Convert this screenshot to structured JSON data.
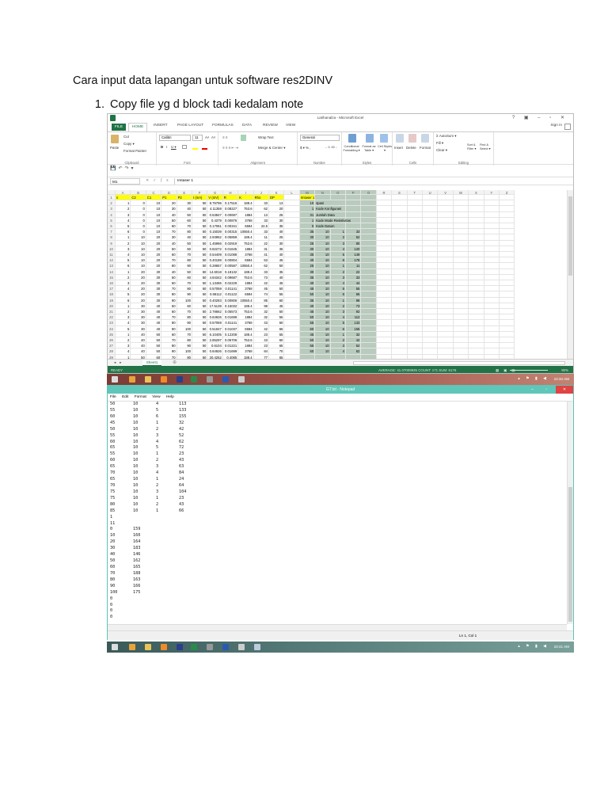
{
  "doc": {
    "title": "Cara input data lapangan untuk software res2DINV",
    "step_number": "1.",
    "step_text": "Copy file yg d block tadi kedalam note"
  },
  "excel": {
    "title": "Latihanalza - Microsoft Excel",
    "window_buttons": "? ▣ – ▫ ✕",
    "sign_in": "Sign in",
    "tabs": [
      "FILE",
      "HOME",
      "INSERT",
      "PAGE LAYOUT",
      "FORMULAS",
      "DATA",
      "REVIEW",
      "VIEW"
    ],
    "ribbon": {
      "clipboard": {
        "label": "Clipboard",
        "paste": "Paste",
        "cut": "Cut",
        "copy": "Copy ▾",
        "format_painter": "Format Painter"
      },
      "font": {
        "label": "Font",
        "name": "Calibri",
        "size": "11",
        "grow": "A˄",
        "shrink": "A˅",
        "bold": "B",
        "italic": "I",
        "underline": "U ▾"
      },
      "alignment": {
        "label": "Alignment",
        "wrap": "Wrap Text",
        "merge": "Merge & Center ▾"
      },
      "number": {
        "label": "Number",
        "format": "General",
        "currency": "$ ▾ % ,",
        "decimals": "←.0 .00→"
      },
      "styles": {
        "label": "Styles",
        "conditional": "Conditional Formatting ▾",
        "format_table": "Format as Table ▾",
        "cell_styles": "Cell Styles ▾"
      },
      "cells": {
        "label": "Cells",
        "insert": "Insert",
        "delete": "Delete",
        "format": "Format"
      },
      "editing": {
        "label": "Editing",
        "autosum": "Σ AutoSum ▾",
        "fill": "Fill ▾",
        "clear": "Clear ▾",
        "sort": "Sort & Filter ▾",
        "find": "Find & Select ▾"
      }
    },
    "name_box": "M1",
    "formula": "Imtaser 1",
    "columns": [
      "A",
      "B",
      "C",
      "D",
      "E",
      "F",
      "G",
      "H",
      "I",
      "J",
      "K",
      "L",
      "M",
      "N",
      "O",
      "P",
      "Q",
      "R",
      "S",
      "T",
      "U",
      "V",
      "W",
      "X",
      "Y",
      "Z"
    ],
    "header_row": [
      "n",
      "C2",
      "C1",
      "P1",
      "P2",
      "I (mA)",
      "V (mV)",
      "R",
      "K",
      "Rho",
      "DP"
    ],
    "rows": [
      [
        "1",
        "0",
        "10",
        "20",
        "30",
        "50",
        "8.75796",
        "0.17516",
        "188.4",
        "33",
        "13"
      ],
      [
        "2",
        "0",
        "10",
        "30",
        "40",
        "50",
        "4.11359",
        "0.08227",
        "753.6",
        "62",
        "20"
      ],
      [
        "3",
        "0",
        "10",
        "40",
        "50",
        "50",
        "0.53847",
        "0.00697",
        "1884",
        "13",
        "25"
      ],
      [
        "4",
        "0",
        "10",
        "50",
        "60",
        "50",
        "0.4379",
        "0.00876",
        "3768",
        "33",
        "30"
      ],
      [
        "5",
        "0",
        "10",
        "60",
        "70",
        "50",
        "0.17061",
        "0.00341",
        "6594",
        "22.5",
        "35"
      ],
      [
        "6",
        "0",
        "10",
        "70",
        "80",
        "50",
        "0.15039",
        "0.00315",
        "10550.4",
        "33",
        "40"
      ],
      [
        "1",
        "10",
        "20",
        "30",
        "40",
        "50",
        "2.93952",
        "0.05859",
        "188.4",
        "11",
        "25"
      ],
      [
        "2",
        "10",
        "20",
        "40",
        "50",
        "50",
        "1.45966",
        "0.02919",
        "753.6",
        "22",
        "30"
      ],
      [
        "3",
        "10",
        "20",
        "50",
        "60",
        "50",
        "0.82272",
        "0.01645",
        "1884",
        "31",
        "35"
      ],
      [
        "4",
        "10",
        "20",
        "60",
        "70",
        "50",
        "0.54409",
        "0.01088",
        "3768",
        "41",
        "40"
      ],
      [
        "5",
        "10",
        "20",
        "70",
        "80",
        "50",
        "0.40188",
        "0.00804",
        "6594",
        "53",
        "45"
      ],
      [
        "6",
        "10",
        "20",
        "80",
        "90",
        "50",
        "0.28657",
        "0.00587",
        "10550.4",
        "62",
        "50"
      ],
      [
        "1",
        "20",
        "30",
        "40",
        "50",
        "50",
        "14.6018",
        "0.18132",
        "188.4",
        "33",
        "35"
      ],
      [
        "2",
        "20",
        "30",
        "50",
        "60",
        "50",
        "4.84342",
        "0.09687",
        "753.6",
        "73",
        "40"
      ],
      [
        "3",
        "20",
        "30",
        "60",
        "70",
        "50",
        "1.13465",
        "0.02229",
        "1884",
        "42",
        "45"
      ],
      [
        "4",
        "20",
        "30",
        "70",
        "80",
        "50",
        "0.57059",
        "0.01141",
        "3768",
        "45",
        "50"
      ],
      [
        "5",
        "20",
        "30",
        "80",
        "90",
        "50",
        "0.58112",
        "0.01122",
        "6594",
        "74",
        "55"
      ],
      [
        "6",
        "20",
        "30",
        "90",
        "100",
        "50",
        "0.40283",
        "0.00806",
        "10550.4",
        "85",
        "60"
      ],
      [
        "1",
        "30",
        "40",
        "50",
        "60",
        "50",
        "17.5139",
        "0.15032",
        "188.4",
        "98",
        "45"
      ],
      [
        "2",
        "30",
        "40",
        "60",
        "70",
        "50",
        "2.78662",
        "0.05573",
        "753.6",
        "32",
        "50"
      ],
      [
        "3",
        "30",
        "40",
        "70",
        "80",
        "50",
        "0.84926",
        "0.01699",
        "1884",
        "32",
        "55"
      ],
      [
        "4",
        "30",
        "40",
        "80",
        "90",
        "50",
        "0.57059",
        "0.01141",
        "3768",
        "43",
        "60"
      ],
      [
        "5",
        "30",
        "40",
        "90",
        "100",
        "50",
        "0.51847",
        "0.01037",
        "6594",
        "42",
        "65"
      ],
      [
        "1",
        "40",
        "50",
        "60",
        "70",
        "50",
        "6.10405",
        "0.12208",
        "188.4",
        "23",
        "55"
      ],
      [
        "2",
        "40",
        "50",
        "70",
        "80",
        "50",
        "2.85297",
        "0.05706",
        "753.6",
        "43",
        "60"
      ],
      [
        "3",
        "40",
        "50",
        "80",
        "90",
        "50",
        "0.6104",
        "0.01221",
        "1884",
        "23",
        "65"
      ],
      [
        "4",
        "40",
        "50",
        "90",
        "100",
        "50",
        "0.84926",
        "0.01699",
        "3768",
        "84",
        "70"
      ],
      [
        "1",
        "50",
        "60",
        "70",
        "80",
        "50",
        "20.4252",
        "0.4085",
        "188.4",
        "77",
        "65"
      ]
    ],
    "m_header": "Imtaser 1",
    "m_info": [
      [
        "10",
        "spasi"
      ],
      [
        "1",
        "Kode Konfigurasi"
      ],
      [
        "31",
        "Jumlah Data"
      ],
      [
        "1",
        "Kode Mode Resistivitas"
      ],
      [
        "0",
        "Kode Datum"
      ]
    ],
    "m_rows": [
      [
        "35",
        "10",
        "1",
        "33"
      ],
      [
        "30",
        "10",
        "2",
        "62"
      ],
      [
        "25",
        "10",
        "3",
        "80"
      ],
      [
        "30",
        "10",
        "4",
        "120"
      ],
      [
        "35",
        "10",
        "5",
        "149"
      ],
      [
        "40",
        "10",
        "6",
        "178"
      ],
      [
        "25",
        "10",
        "1",
        "11"
      ],
      [
        "30",
        "10",
        "2",
        "22"
      ],
      [
        "35",
        "10",
        "3",
        "33"
      ],
      [
        "40",
        "10",
        "4",
        "44"
      ],
      [
        "45",
        "10",
        "5",
        "55"
      ],
      [
        "50",
        "10",
        "6",
        "66"
      ],
      [
        "35",
        "10",
        "1",
        "98"
      ],
      [
        "40",
        "10",
        "2",
        "73"
      ],
      [
        "45",
        "10",
        "3",
        "92"
      ],
      [
        "50",
        "10",
        "4",
        "112"
      ],
      [
        "55",
        "10",
        "5",
        "133"
      ],
      [
        "60",
        "10",
        "6",
        "155"
      ],
      [
        "45",
        "10",
        "1",
        "32"
      ],
      [
        "50",
        "10",
        "2",
        "42"
      ],
      [
        "55",
        "10",
        "3",
        "52"
      ],
      [
        "60",
        "10",
        "4",
        "62"
      ]
    ],
    "sheet_tab": "Sheet1",
    "add_sheet": "⊕",
    "status_ready": "READY",
    "status_stats": "AVERAGE: 41.07009925    COUNT: 171    SUM: 6176",
    "zoom": "90%"
  },
  "taskbar1": {
    "time": "10:34 AM",
    "tray": "▴ ⚑ ▮ ◀"
  },
  "notepad": {
    "title": "GT.txt - Notepad",
    "window_buttons": "– ▫",
    "close": "✕",
    "menu": [
      "File",
      "Edit",
      "Format",
      "View",
      "Help"
    ],
    "lines": [
      [
        "50",
        "10",
        "4",
        "113"
      ],
      [
        "55",
        "10",
        "5",
        "133"
      ],
      [
        "60",
        "10",
        "6",
        "155"
      ],
      [
        "45",
        "10",
        "1",
        "32"
      ],
      [
        "50",
        "10",
        "2",
        "42"
      ],
      [
        "55",
        "10",
        "3",
        "52"
      ],
      [
        "60",
        "10",
        "4",
        "62"
      ],
      [
        "65",
        "10",
        "5",
        "72"
      ],
      [
        "55",
        "10",
        "1",
        "23"
      ],
      [
        "60",
        "10",
        "2",
        "43"
      ],
      [
        "65",
        "10",
        "3",
        "63"
      ],
      [
        "70",
        "10",
        "4",
        "84"
      ],
      [
        "65",
        "10",
        "1",
        "24"
      ],
      [
        "70",
        "10",
        "2",
        "64"
      ],
      [
        "75",
        "10",
        "3",
        "104"
      ],
      [
        "75",
        "10",
        "1",
        "23"
      ],
      [
        "80",
        "10",
        "2",
        "43"
      ],
      [
        "85",
        "10",
        "1",
        "66"
      ],
      [
        "1"
      ],
      [
        "11"
      ],
      [
        "0",
        "159"
      ],
      [
        "10",
        "160"
      ],
      [
        "20",
        "164"
      ],
      [
        "30",
        "183"
      ],
      [
        "40",
        "146"
      ],
      [
        "50",
        "162"
      ],
      [
        "60",
        "165"
      ],
      [
        "70",
        "188"
      ],
      [
        "80",
        "163"
      ],
      [
        "90",
        "166"
      ],
      [
        "100",
        "175"
      ],
      [
        "0"
      ],
      [
        "0"
      ],
      [
        "0"
      ],
      [
        "0"
      ]
    ],
    "cursor_position": "Ln 1, Col 1"
  },
  "taskbar2": {
    "time": "10:41 AM",
    "tray": "▴ ⚑ ▮ ◀"
  },
  "colors": {
    "excel_green": "#217346",
    "header_yellow": "#ffff00",
    "notepad_title": "#5fc7b9",
    "close_red": "#e04343"
  }
}
